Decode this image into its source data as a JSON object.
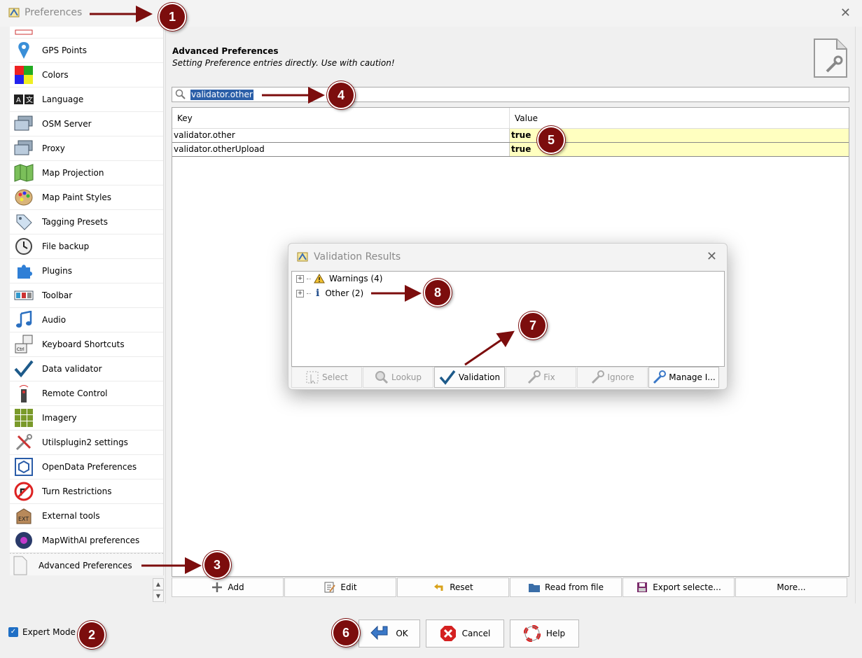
{
  "window": {
    "title": "Preferences"
  },
  "sidebar": {
    "items": [
      {
        "label": "GPS Points",
        "icon": "gps-pin-icon"
      },
      {
        "label": "Colors",
        "icon": "colors-icon"
      },
      {
        "label": "Language",
        "icon": "language-icon"
      },
      {
        "label": "OSM Server",
        "icon": "server-icon"
      },
      {
        "label": "Proxy",
        "icon": "proxy-icon"
      },
      {
        "label": "Map Projection",
        "icon": "map-projection-icon"
      },
      {
        "label": "Map Paint Styles",
        "icon": "palette-icon"
      },
      {
        "label": "Tagging Presets",
        "icon": "tag-icon"
      },
      {
        "label": "File backup",
        "icon": "clock-icon"
      },
      {
        "label": "Plugins",
        "icon": "puzzle-icon"
      },
      {
        "label": "Toolbar",
        "icon": "toolbar-icon"
      },
      {
        "label": "Audio",
        "icon": "music-note-icon"
      },
      {
        "label": "Keyboard Shortcuts",
        "icon": "keyboard-icon"
      },
      {
        "label": "Data validator",
        "icon": "checkmark-icon"
      },
      {
        "label": "Remote Control",
        "icon": "remote-icon"
      },
      {
        "label": "Imagery",
        "icon": "imagery-grid-icon"
      },
      {
        "label": "Utilsplugin2 settings",
        "icon": "tools-icon"
      },
      {
        "label": "OpenData Preferences",
        "icon": "opendata-icon"
      },
      {
        "label": "Turn Restrictions",
        "icon": "turn-restriction-icon"
      },
      {
        "label": "External tools",
        "icon": "ext-icon"
      },
      {
        "label": "MapWithAI preferences",
        "icon": "mapwithai-icon"
      },
      {
        "label": "Advanced Preferences",
        "icon": "advanced-doc-icon"
      }
    ]
  },
  "main": {
    "title": "Advanced Preferences",
    "subtitle": "Setting Preference entries directly. Use with caution!",
    "search_value": "validator.other",
    "columns": [
      "Key",
      "Value"
    ],
    "rows": [
      {
        "key": "validator.other",
        "value": "true"
      },
      {
        "key": "validator.otherUpload",
        "value": "true"
      }
    ],
    "buttons": [
      "Add",
      "Edit",
      "Reset",
      "Read from file",
      "Export selecte...",
      "More..."
    ]
  },
  "bottom": {
    "expert_mode": "Expert Mode",
    "ok": "OK",
    "cancel": "Cancel",
    "help": "Help"
  },
  "validation": {
    "title": "Validation Results",
    "nodes": [
      "Warnings (4)",
      "Other (2)"
    ],
    "buttons": [
      "Select",
      "Lookup",
      "Validation",
      "Fix",
      "Ignore",
      "Manage I..."
    ]
  },
  "badges": [
    "1",
    "2",
    "3",
    "4",
    "5",
    "6",
    "7",
    "8"
  ],
  "colors": {
    "accent": "#2b5fa8",
    "badge": "#7c0d0d",
    "highlight": "#ffffc0"
  }
}
